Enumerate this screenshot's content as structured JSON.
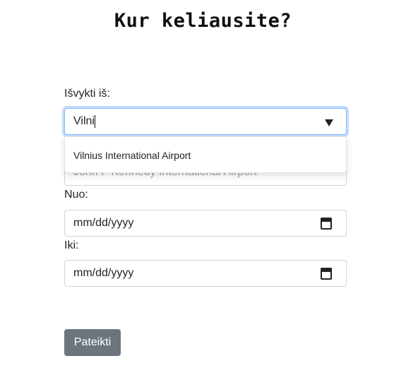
{
  "title": "Kur keliausite?",
  "form": {
    "from_label": "Išvykti iš:",
    "from_value": "Vilni",
    "dropdown_suggestion": "Vilnius International Airport",
    "to_value_partial": "John F Kennedy International Airport",
    "nuo_label": "Nuo:",
    "nuo_placeholder": "mm/dd/yyyy",
    "iki_label": "Iki:",
    "iki_placeholder": "mm/dd/yyyy",
    "submit_label": "Pateikti"
  },
  "icons": {
    "date_picker": "calendar-icon",
    "select_arrow": "triangle-down-icon"
  },
  "colors": {
    "focus_border": "#86b7fe",
    "button_bg": "#6c757d",
    "button_text": "#ffffff"
  }
}
